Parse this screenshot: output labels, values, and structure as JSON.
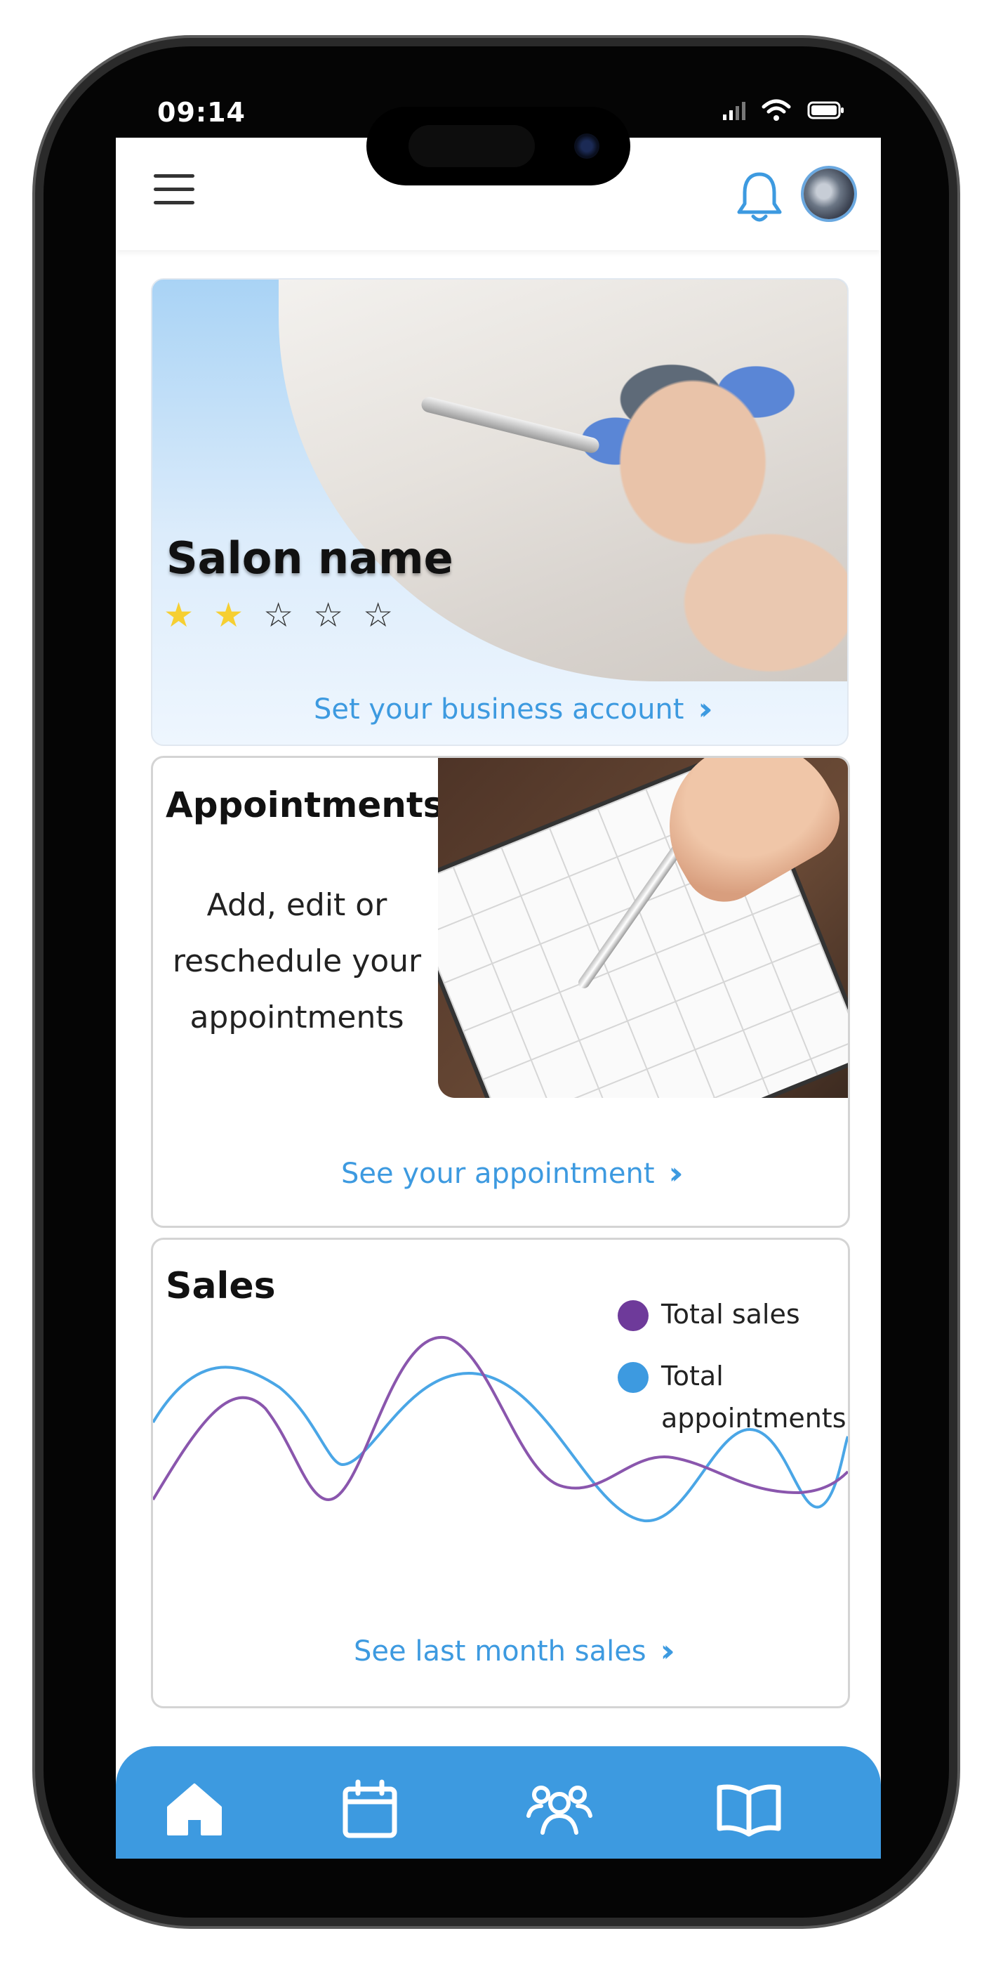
{
  "status": {
    "time": "09:14"
  },
  "colors": {
    "accent": "#3d9ae0",
    "sales_series": "#6e3a9a",
    "appointments_series": "#3d9ae0",
    "star_on": "#f6cf32"
  },
  "header": {
    "menu_icon": "hamburger-icon",
    "notification_icon": "bell-icon",
    "avatar": "avatar"
  },
  "hero": {
    "salon_name": "Salon name",
    "rating": {
      "value": 2,
      "max": 5
    },
    "cta": "Set your business account"
  },
  "appointments": {
    "title": "Appointments",
    "description": "Add, edit or reschedule your appointments",
    "cta": "See your appointment"
  },
  "sales": {
    "title": "Sales",
    "legend": [
      {
        "label": "Total sales"
      },
      {
        "label": "Total appointments"
      }
    ],
    "cta": "See last month sales"
  },
  "nav": [
    {
      "icon": "home-icon"
    },
    {
      "icon": "calendar-icon"
    },
    {
      "icon": "users-icon"
    },
    {
      "icon": "book-icon"
    }
  ]
}
